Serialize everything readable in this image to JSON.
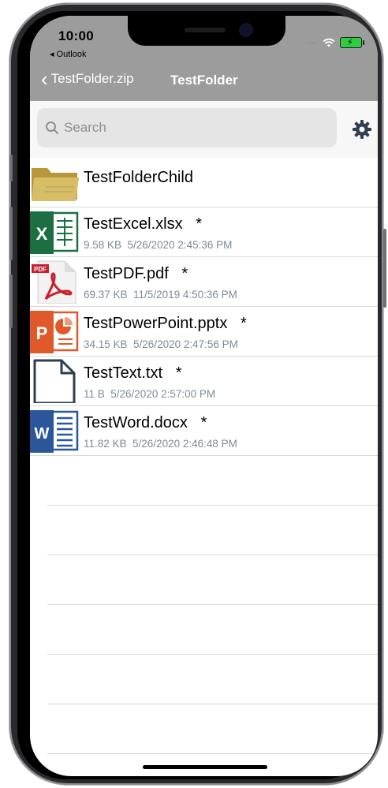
{
  "status": {
    "time": "10:00",
    "back_app": "◂ Outlook"
  },
  "nav": {
    "back_label": "TestFolder.zip",
    "title": "TestFolder"
  },
  "search": {
    "placeholder": "Search"
  },
  "files": [
    {
      "name": "TestFolderChild",
      "meta": "",
      "icon": "folder-icon",
      "color": "#c9a94a"
    },
    {
      "name": "TestExcel.xlsx   *",
      "meta": "9.58 KB  5/26/2020 2:45:36 PM",
      "icon": "excel-icon",
      "color": "#1d6f42"
    },
    {
      "name": "TestPDF.pdf   *",
      "meta": "69.37 KB  11/5/2019 4:50:36 PM",
      "icon": "pdf-icon",
      "color": "#c8202f"
    },
    {
      "name": "TestPowerPoint.pptx   *",
      "meta": "34.15 KB  5/26/2020 2:47:56 PM",
      "icon": "powerpoint-icon",
      "color": "#e0592a"
    },
    {
      "name": "TestText.txt   *",
      "meta": "11 B  5/26/2020 2:57:00 PM",
      "icon": "text-file-icon",
      "color": "#2c3e50"
    },
    {
      "name": "TestWord.docx   *",
      "meta": "11.82 KB  5/26/2020 2:46:48 PM",
      "icon": "word-icon",
      "color": "#2b579a"
    }
  ],
  "colors": {
    "nav_bar": "#9c9c9c",
    "meta_text": "#7d8a99"
  }
}
